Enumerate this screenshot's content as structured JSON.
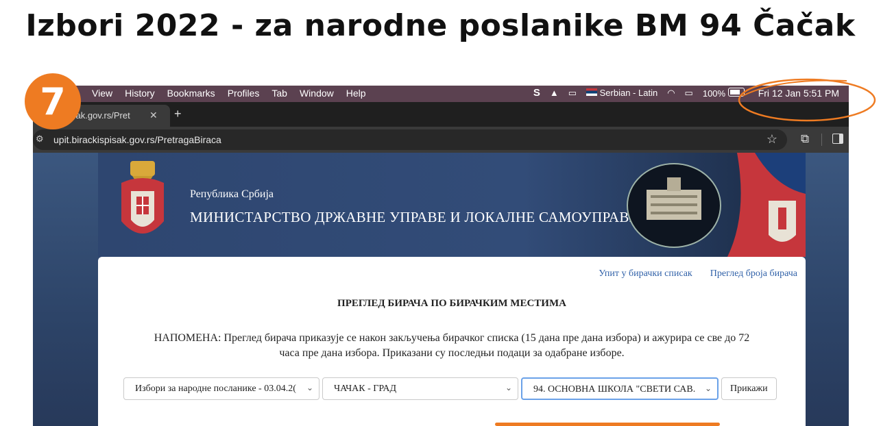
{
  "slide": {
    "title": "Izbori 2022 - za narodne poslanike BM 94 Čačak",
    "step_number": "7",
    "accent_color": "#ee7b22"
  },
  "menubar": {
    "items": [
      "View",
      "History",
      "Bookmarks",
      "Profiles",
      "Tab",
      "Window",
      "Help"
    ],
    "input_source": "Serbian - Latin",
    "battery": "100%",
    "clock": "Fri 12 Jan  5:51 PM"
  },
  "browser": {
    "tab_title": "sak.gov.rs/Pret",
    "url": "upit.birackispisak.gov.rs/PretragaBiraca"
  },
  "page": {
    "republic": "Република Србија",
    "ministry": "МИНИСТАРСТВО ДРЖАВНЕ УПРАВЕ И ЛОКАЛНЕ САМОУПРАВЕ",
    "links": [
      "Упит у бирачки списак",
      "Преглед броја бирача"
    ],
    "heading": "ПРЕГЛЕД БИРАЧА ПО БИРАЧКИМ МЕСТИМА",
    "note": "НАПОМЕНА: Преглед бирача приказује се након закључења бирачког списка (15 дана пре дана избора) и ажурира се све до 72 часа пре дана избора. Приказани су последњи подаци за одабране изборе.",
    "election_select": "Избори за народне посланике - 03.04.2(",
    "municipality_select": "ЧАЧАК - ГРАД",
    "polling_station_select": "94. ОСНОВНА ШКОЛА \"СВЕТИ САВ.",
    "show_button": "Прикажи"
  }
}
